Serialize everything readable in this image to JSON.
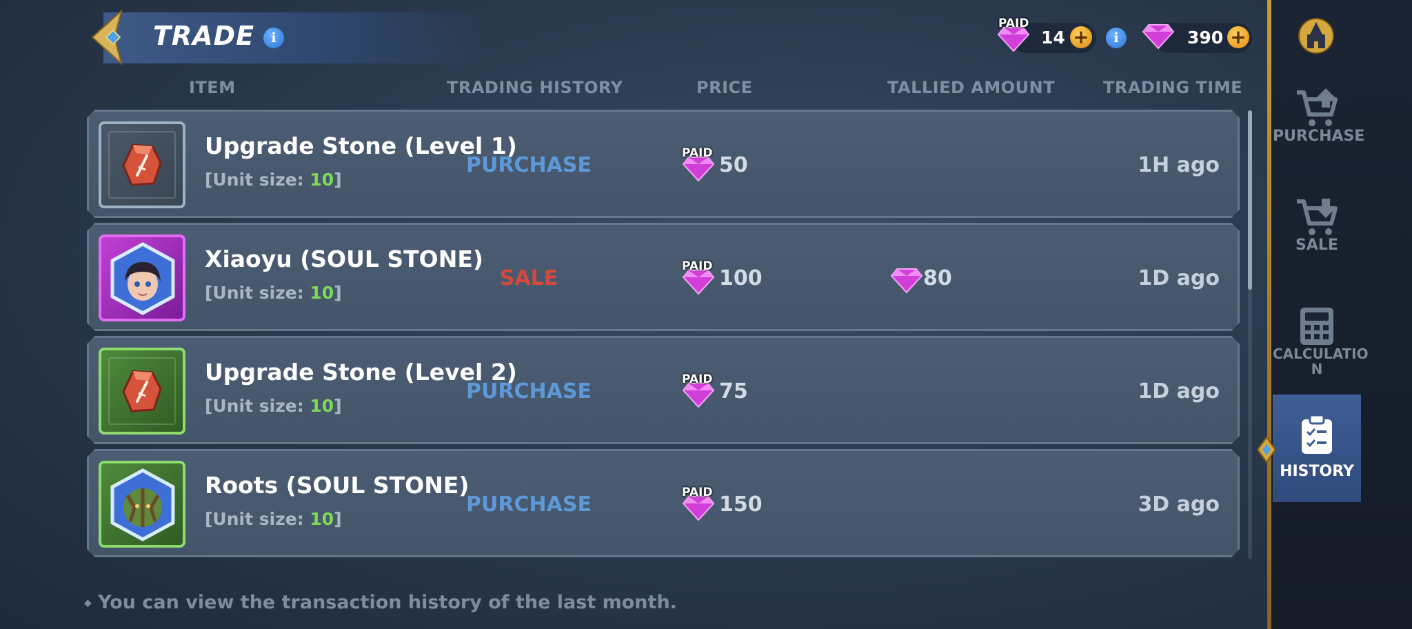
{
  "header": {
    "title": "TRADE",
    "currencies": [
      {
        "tag": "PAID",
        "value": "14",
        "icon": "gem-icon"
      },
      {
        "value": "390",
        "icon": "gem-icon"
      }
    ]
  },
  "columns": {
    "item": "ITEM",
    "trading_history": "TRADING HISTORY",
    "price": "PRICE",
    "tallied_amount": "TALLIED AMOUNT",
    "trading_time": "TRADING TIME"
  },
  "rows": [
    {
      "name": "Upgrade Stone (Level 1)",
      "unit_prefix": "[Unit size: ",
      "unit_size": "10",
      "unit_suffix": "]",
      "type": "PURCHASE",
      "price_tag": "PAID",
      "price": "50",
      "tallied": "",
      "time": "1H ago",
      "rarity": "gray",
      "icon": "upgrade-stone-icon"
    },
    {
      "name": "Xiaoyu (SOUL STONE)",
      "unit_prefix": "[Unit size: ",
      "unit_size": "10",
      "unit_suffix": "]",
      "type": "SALE",
      "price_tag": "PAID",
      "price": "100",
      "tallied": "80",
      "time": "1D ago",
      "rarity": "purple",
      "icon": "xiaoyu-portrait-icon"
    },
    {
      "name": "Upgrade Stone (Level 2)",
      "unit_prefix": "[Unit size: ",
      "unit_size": "10",
      "unit_suffix": "]",
      "type": "PURCHASE",
      "price_tag": "PAID",
      "price": "75",
      "tallied": "",
      "time": "1D ago",
      "rarity": "green",
      "icon": "upgrade-stone-icon"
    },
    {
      "name": "Roots (SOUL STONE)",
      "unit_prefix": "[Unit size: ",
      "unit_size": "10",
      "unit_suffix": "]",
      "type": "PURCHASE",
      "price_tag": "PAID",
      "price": "150",
      "tallied": "",
      "time": "3D ago",
      "rarity": "green",
      "icon": "roots-portrait-icon"
    }
  ],
  "footer": {
    "note": "You can view the transaction history of the last month."
  },
  "side_nav": {
    "items": [
      {
        "label": "PURCHASE",
        "icon": "cart-up-icon",
        "active": false
      },
      {
        "label": "SALE",
        "icon": "cart-down-icon",
        "active": false
      },
      {
        "label": "CALCULATIO\nN",
        "icon": "calculator-icon",
        "active": false
      },
      {
        "label": "HISTORY",
        "icon": "clipboard-icon",
        "active": true
      }
    ]
  },
  "colors": {
    "purchase": "#5d98d8",
    "sale": "#d24a3e",
    "unit_number": "#7ed957",
    "accent_gold": "#c79a3a"
  }
}
